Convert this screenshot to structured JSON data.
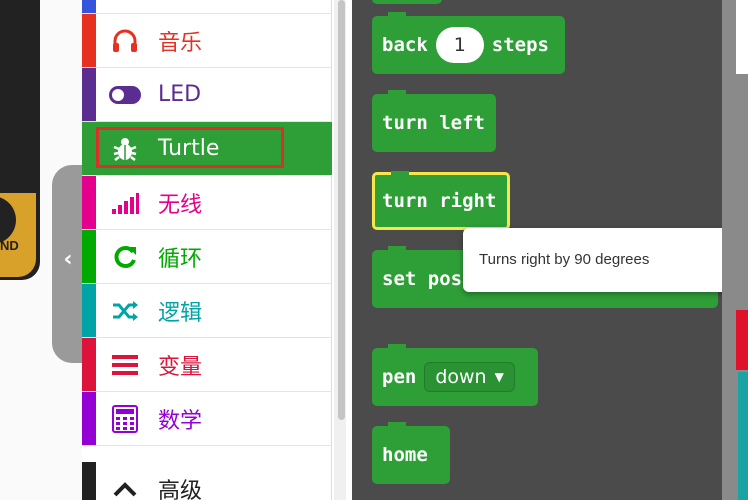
{
  "simulator": {
    "board_label": "ND",
    "collapse_icon": "chevron-left-icon"
  },
  "toolbox": {
    "categories": [
      {
        "id": "music",
        "label": "音乐",
        "icon": "headphones-icon",
        "color": "#e63022"
      },
      {
        "id": "led",
        "label": "LED",
        "icon": "toggle-icon",
        "color": "#5c2d91"
      },
      {
        "id": "turtle",
        "label": "Turtle",
        "icon": "bug-icon",
        "color": "#2e9e37",
        "selected": true
      },
      {
        "id": "radio",
        "label": "无线",
        "icon": "signal-bars-icon",
        "color": "#e3008c"
      },
      {
        "id": "loops",
        "label": "循环",
        "icon": "refresh-icon",
        "color": "#00aa00"
      },
      {
        "id": "logic",
        "label": "逻辑",
        "icon": "shuffle-icon",
        "color": "#00a4a6"
      },
      {
        "id": "variables",
        "label": "变量",
        "icon": "lines-icon",
        "color": "#dc143c"
      },
      {
        "id": "math",
        "label": "数学",
        "icon": "calculator-icon",
        "color": "#9400d3"
      },
      {
        "id": "advanced",
        "label": "高级",
        "icon": "chevron-up-icon",
        "color": "#212121"
      }
    ]
  },
  "flyout": {
    "back_block": {
      "label": "back",
      "value": "1",
      "suffix": "steps"
    },
    "turn_left_block": {
      "label": "turn left"
    },
    "turn_right_block": {
      "label": "turn right"
    },
    "set_pos_block": {
      "label": "set pos"
    },
    "pen_block": {
      "label": "pen",
      "option": "down"
    },
    "home_block": {
      "label": "home"
    }
  },
  "tooltip": {
    "text": "Turns right by 90 degrees"
  }
}
